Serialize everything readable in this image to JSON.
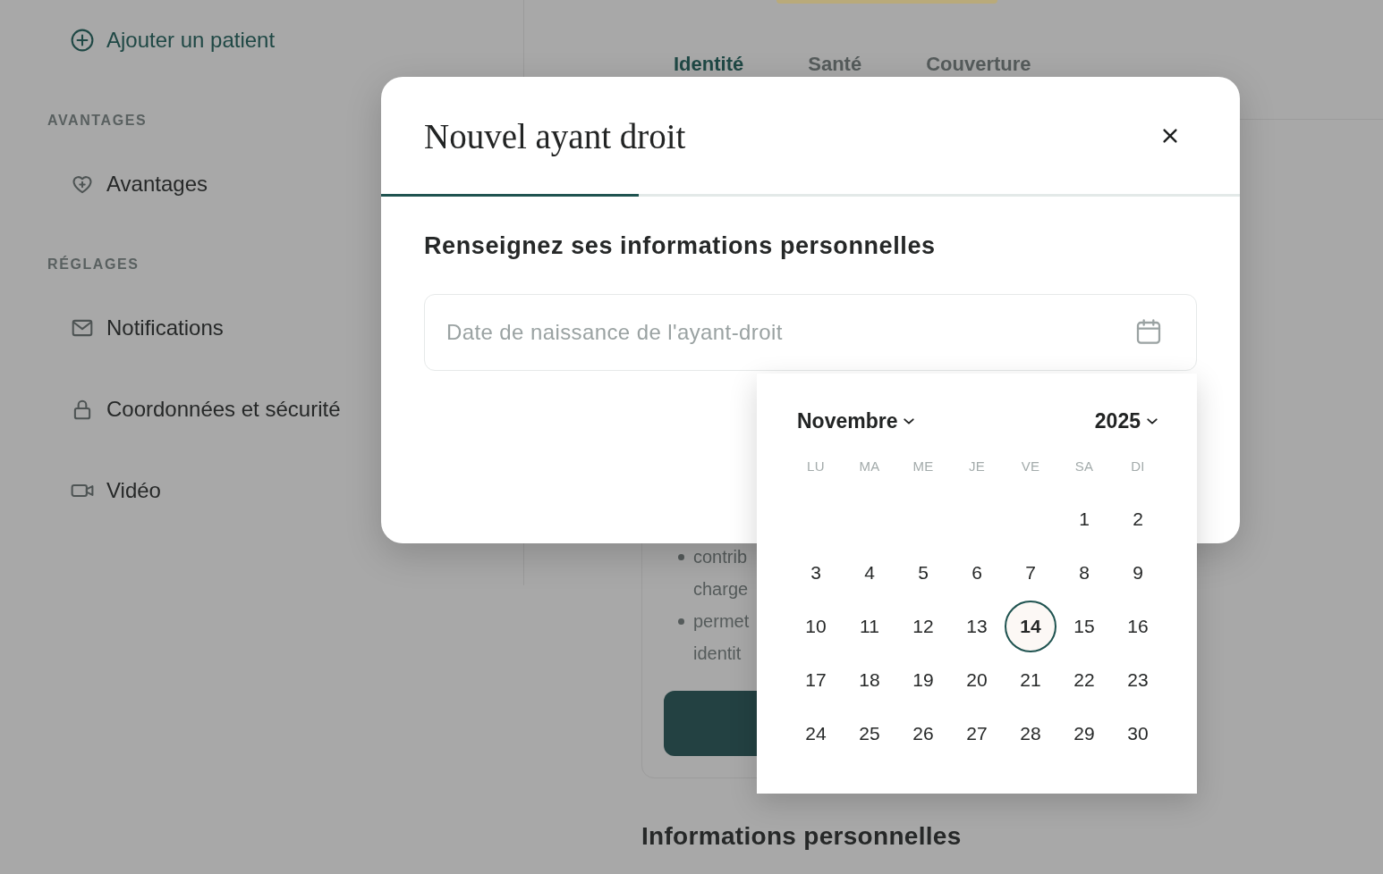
{
  "sidebar": {
    "add_patient": {
      "label": "Ajouter un patient"
    },
    "sections": [
      {
        "title": "AVANTAGES",
        "items": [
          {
            "label": "Avantages"
          }
        ]
      },
      {
        "title": "RÉGLAGES",
        "items": [
          {
            "label": "Notifications"
          },
          {
            "label": "Coordonnées et sécurité"
          },
          {
            "label": "Vidéo"
          }
        ]
      }
    ]
  },
  "main": {
    "tabs": [
      {
        "label": "Identité",
        "selected": true
      },
      {
        "label": "Santé",
        "selected": false
      },
      {
        "label": "Couverture",
        "selected": false
      }
    ],
    "card": {
      "bullets": [
        {
          "lines": [
            "contrib",
            "charge"
          ]
        },
        {
          "lines": [
            "permet",
            "identit"
          ]
        }
      ]
    },
    "section_heading": "Informations personnelles"
  },
  "modal": {
    "title": "Nouvel ayant droit",
    "progress": {
      "level": 0.3
    },
    "heading": "Renseignez ses informations personnelles",
    "date_field": {
      "placeholder": "Date de naissance de l'ayant-droit"
    },
    "date_picker": {
      "month": "Novembre",
      "year": "2025",
      "weekdays": [
        "LU",
        "MA",
        "ME",
        "JE",
        "VE",
        "SA",
        "DI"
      ],
      "weeks": [
        {
          "align_end": true,
          "days": [
            {
              "label": "1",
              "selected": false
            },
            {
              "label": "2",
              "selected": false
            }
          ]
        },
        {
          "days": [
            {
              "label": "3",
              "selected": false
            },
            {
              "label": "4",
              "selected": false
            },
            {
              "label": "5",
              "selected": false
            },
            {
              "label": "6",
              "selected": false
            },
            {
              "label": "7",
              "selected": false
            },
            {
              "label": "8",
              "selected": false
            },
            {
              "label": "9",
              "selected": false
            }
          ]
        },
        {
          "days": [
            {
              "label": "10",
              "selected": false
            },
            {
              "label": "11",
              "selected": false
            },
            {
              "label": "12",
              "selected": false
            },
            {
              "label": "13",
              "selected": false
            },
            {
              "label": "14",
              "selected": true
            },
            {
              "label": "15",
              "selected": false
            },
            {
              "label": "16",
              "selected": false
            }
          ]
        },
        {
          "days": [
            {
              "label": "17",
              "selected": false
            },
            {
              "label": "18",
              "selected": false
            },
            {
              "label": "19",
              "selected": false
            },
            {
              "label": "20",
              "selected": false
            },
            {
              "label": "21",
              "selected": false
            },
            {
              "label": "22",
              "selected": false
            },
            {
              "label": "23",
              "selected": false
            }
          ]
        },
        {
          "days": [
            {
              "label": "24",
              "selected": false
            },
            {
              "label": "25",
              "selected": false
            },
            {
              "label": "26",
              "selected": false
            },
            {
              "label": "27",
              "selected": false
            },
            {
              "label": "28",
              "selected": false
            },
            {
              "label": "29",
              "selected": false
            },
            {
              "label": "30",
              "selected": false
            }
          ]
        }
      ]
    }
  }
}
